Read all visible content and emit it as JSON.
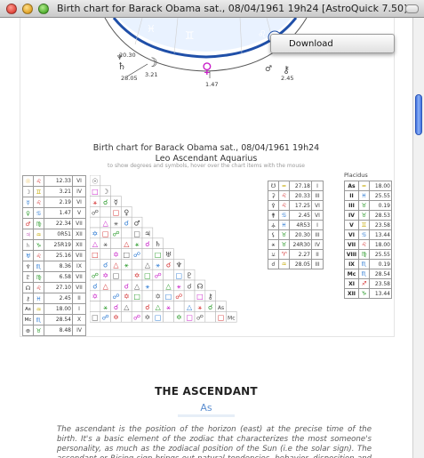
{
  "window": {
    "title": "Birth chart for Barack Obama sat., 08/04/1961 19h24 [AstroQuick 7.50]"
  },
  "menu": {
    "download_label": "Download"
  },
  "wheel": {
    "degree_labels": [
      "20.30",
      "3.21",
      "28.05",
      "1.47",
      "2.45"
    ]
  },
  "chart": {
    "title": "Birth chart for Barack Obama sat., 08/04/1961 19h24",
    "subtitle": "Leo Ascendant Aquarius",
    "hint": "to show degrees and symbols, hover over the chart items with the mouse"
  },
  "planets": [
    {
      "glyph": "☉",
      "color": "#e0a000",
      "sign": "♌",
      "sign_color": "#d43333",
      "deg": "12.33",
      "house": "VI"
    },
    {
      "glyph": "☽",
      "color": "#555555",
      "sign": "♊",
      "sign_color": "#c3a800",
      "deg": "3.21",
      "house": "IV"
    },
    {
      "glyph": "☿",
      "color": "#2e7bd3",
      "sign": "♌",
      "sign_color": "#d43333",
      "deg": "2.19",
      "house": "VI"
    },
    {
      "glyph": "♀",
      "color": "#2a9a2a",
      "sign": "♋",
      "sign_color": "#2e7bd3",
      "deg": "1.47",
      "house": "V"
    },
    {
      "glyph": "♂",
      "color": "#d43333",
      "sign": "♍",
      "sign_color": "#2a9a2a",
      "deg": "22.34",
      "house": "VII"
    },
    {
      "glyph": "♃",
      "color": "#c86fc0",
      "sign": "♒",
      "sign_color": "#c3a800",
      "deg": "0R51",
      "house": "XII"
    },
    {
      "glyph": "♄",
      "color": "#777777",
      "sign": "♑",
      "sign_color": "#2a9a2a",
      "deg": "25R19",
      "house": "XII"
    },
    {
      "glyph": "♅",
      "color": "#2e7bd3",
      "sign": "♌",
      "sign_color": "#d43333",
      "deg": "25.16",
      "house": "VII"
    },
    {
      "glyph": "♆",
      "color": "#555555",
      "sign": "♏",
      "sign_color": "#2e7bd3",
      "deg": "8.36",
      "house": "IX"
    },
    {
      "glyph": "♇",
      "color": "#555555",
      "sign": "♍",
      "sign_color": "#2a9a2a",
      "deg": "6.58",
      "house": "VII"
    },
    {
      "glyph": "☊",
      "color": "#444444",
      "sign": "♌",
      "sign_color": "#d43333",
      "deg": "27.10",
      "house": "VII"
    },
    {
      "glyph": "⚷",
      "color": "#444444",
      "sign": "♓",
      "sign_color": "#2e7bd3",
      "deg": "2.45",
      "house": "II"
    },
    {
      "glyph": "As",
      "color": "#222222",
      "sign": "♒",
      "sign_color": "#c3a800",
      "deg": "18.00",
      "house": "I"
    },
    {
      "glyph": "Mc",
      "color": "#222222",
      "sign": "♏",
      "sign_color": "#2e7bd3",
      "deg": "28.54",
      "house": "X"
    },
    {
      "glyph": "⊕",
      "color": "#444444",
      "sign": "♉",
      "sign_color": "#2a9a2a",
      "deg": "8.48",
      "house": "IV"
    }
  ],
  "aspect_diagonal": [
    "☉",
    "☽",
    "☿",
    "♀",
    "♂",
    "♃",
    "♄",
    "♅",
    "♆",
    "♇",
    "☊",
    "⚷",
    "As",
    "Mc"
  ],
  "houses_mid": [
    {
      "glyph": "☋",
      "sign": "≈",
      "deg": "27.18",
      "house": "I"
    },
    {
      "glyph": "⚳",
      "sign": "♌",
      "deg": "20.33",
      "house": "III"
    },
    {
      "glyph": "⚴",
      "sign": "♌",
      "deg": "17.25",
      "house": "VI"
    },
    {
      "glyph": "⚵",
      "sign": "♋",
      "deg": "2.45",
      "house": "VI"
    },
    {
      "glyph": "⚶",
      "sign": "♓",
      "deg": "4R53",
      "house": "I"
    },
    {
      "glyph": "⚸",
      "sign": "♉",
      "deg": "20.30",
      "house": "III"
    },
    {
      "glyph": "⚹",
      "sign": "♉",
      "deg": "24R30",
      "house": "IV"
    },
    {
      "glyph": "⚺",
      "sign": "♈",
      "deg": "2.27",
      "house": "II"
    },
    {
      "glyph": "☌",
      "sign": "♒",
      "deg": "28.05",
      "house": "III"
    }
  ],
  "placidus": {
    "label": "Placidus",
    "rows": [
      {
        "house": "As",
        "sign": "≈",
        "deg": "18.00"
      },
      {
        "house": "II",
        "sign": "♓",
        "deg": "25.55"
      },
      {
        "house": "III",
        "sign": "♉",
        "deg": "0.19"
      },
      {
        "house": "IV",
        "sign": "♉",
        "deg": "28.53"
      },
      {
        "house": "V",
        "sign": "♊",
        "deg": "23.58"
      },
      {
        "house": "VI",
        "sign": "♋",
        "deg": "13.44"
      },
      {
        "house": "VII",
        "sign": "♌",
        "deg": "18.00"
      },
      {
        "house": "VIII",
        "sign": "♍",
        "deg": "25.55"
      },
      {
        "house": "IX",
        "sign": "♏",
        "deg": "0.19"
      },
      {
        "house": "Mc",
        "sign": "♏",
        "deg": "28.54"
      },
      {
        "house": "XI",
        "sign": "♐",
        "deg": "23.58"
      },
      {
        "house": "XII",
        "sign": "♑",
        "deg": "13.44"
      }
    ]
  },
  "ascendant": {
    "heading": "THE ASCENDANT",
    "subheading": "As",
    "paragraph": "The ascendant is the position of the horizon (east) at the precise time of the birth. It's a basic element of the zodiac that characterizes the most someone's personality, as much as the zodiacal position of the Sun (i.e the solar sign). The ascendant or Rising sign brings out natural tendencies, behavior, disposition and potentials."
  }
}
